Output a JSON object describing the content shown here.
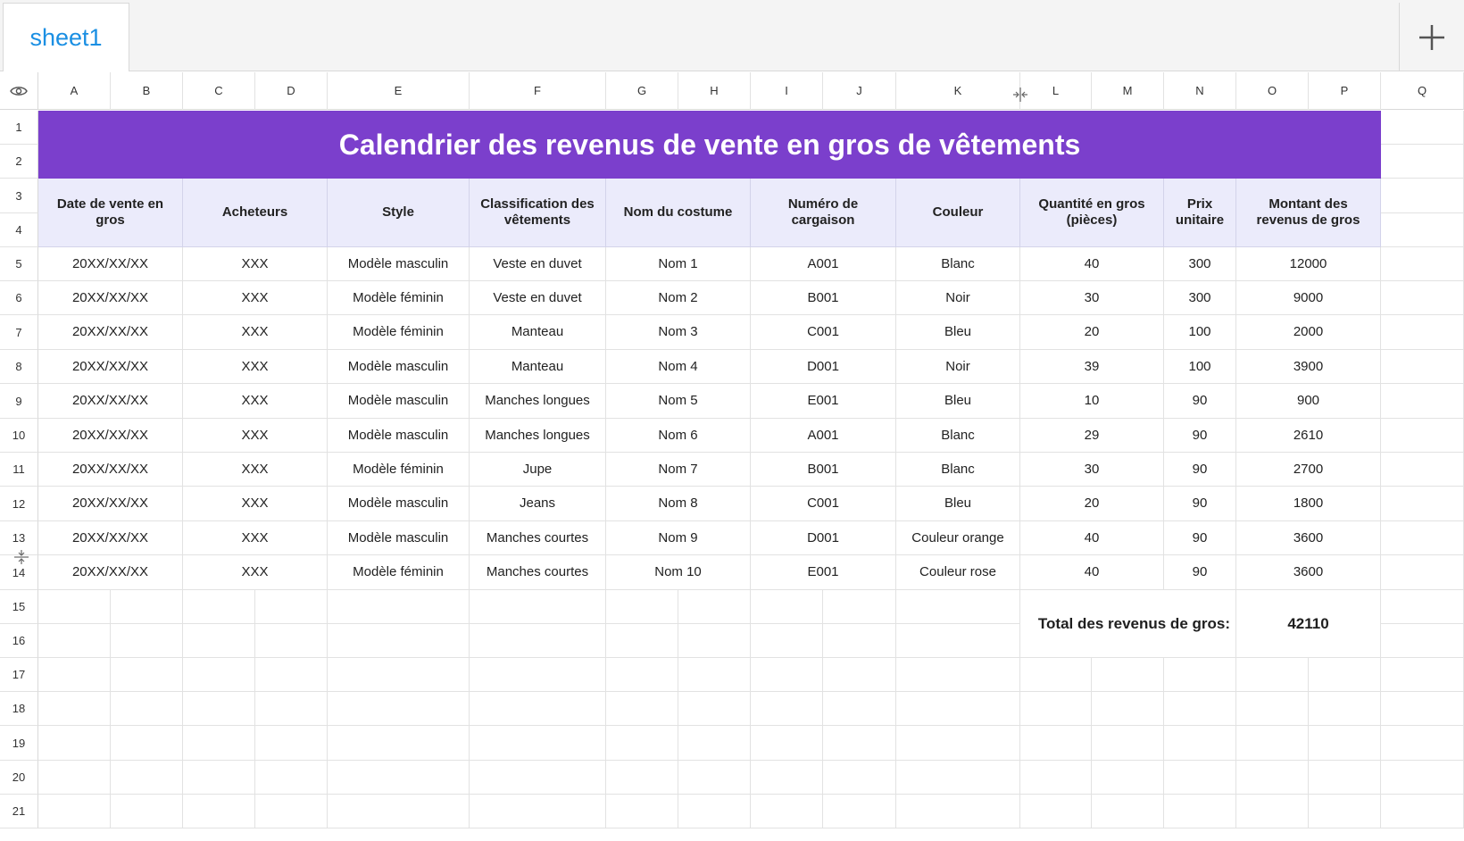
{
  "tabs": {
    "active": "sheet1"
  },
  "icons": {
    "add": "plus-icon",
    "visibility": "eye-icon",
    "resize": "resize-handle-icon"
  },
  "colors": {
    "title_bg": "#7b3fcc",
    "header_bg": "#ebebfb",
    "tab_text": "#1a8fe3"
  },
  "columns": [
    "A",
    "B",
    "C",
    "D",
    "E",
    "F",
    "G",
    "H",
    "I",
    "J",
    "K",
    "L",
    "M",
    "N",
    "O",
    "P",
    "Q"
  ],
  "rows": [
    "1",
    "2",
    "3",
    "4",
    "5",
    "6",
    "7",
    "8",
    "9",
    "10",
    "11",
    "12",
    "13",
    "14",
    "15",
    "16",
    "17",
    "18",
    "19",
    "20",
    "21"
  ],
  "sheet": {
    "title": "Calendrier des revenus de vente en gros de vêtements",
    "headers": [
      "Date de vente en gros",
      "Acheteurs",
      "Style",
      "Classification des vêtements",
      "Nom du costume",
      "Numéro de cargaison",
      "Couleur",
      "Quantité en gros (pièces)",
      "Prix unitaire",
      "Montant des revenus de gros"
    ],
    "data": [
      [
        "20XX/XX/XX",
        "XXX",
        "Modèle masculin",
        "Veste en duvet",
        "Nom 1",
        "A001",
        "Blanc",
        "40",
        "300",
        "12000"
      ],
      [
        "20XX/XX/XX",
        "XXX",
        "Modèle féminin",
        "Veste en duvet",
        "Nom 2",
        "B001",
        "Noir",
        "30",
        "300",
        "9000"
      ],
      [
        "20XX/XX/XX",
        "XXX",
        "Modèle féminin",
        "Manteau",
        "Nom 3",
        "C001",
        "Bleu",
        "20",
        "100",
        "2000"
      ],
      [
        "20XX/XX/XX",
        "XXX",
        "Modèle masculin",
        "Manteau",
        "Nom 4",
        "D001",
        "Noir",
        "39",
        "100",
        "3900"
      ],
      [
        "20XX/XX/XX",
        "XXX",
        "Modèle masculin",
        "Manches longues",
        "Nom 5",
        "E001",
        "Bleu",
        "10",
        "90",
        "900"
      ],
      [
        "20XX/XX/XX",
        "XXX",
        "Modèle masculin",
        "Manches longues",
        "Nom 6",
        "A001",
        "Blanc",
        "29",
        "90",
        "2610"
      ],
      [
        "20XX/XX/XX",
        "XXX",
        "Modèle féminin",
        "Jupe",
        "Nom 7",
        "B001",
        "Blanc",
        "30",
        "90",
        "2700"
      ],
      [
        "20XX/XX/XX",
        "XXX",
        "Modèle masculin",
        "Jeans",
        "Nom 8",
        "C001",
        "Bleu",
        "20",
        "90",
        "1800"
      ],
      [
        "20XX/XX/XX",
        "XXX",
        "Modèle masculin",
        "Manches courtes",
        "Nom 9",
        "D001",
        "Couleur orange",
        "40",
        "90",
        "3600"
      ],
      [
        "20XX/XX/XX",
        "XXX",
        "Modèle féminin",
        "Manches courtes",
        "Nom 10",
        "E001",
        "Couleur rose",
        "40",
        "90",
        "3600"
      ]
    ],
    "total_label": "Total des revenus de gros:",
    "total_value": "42110"
  }
}
